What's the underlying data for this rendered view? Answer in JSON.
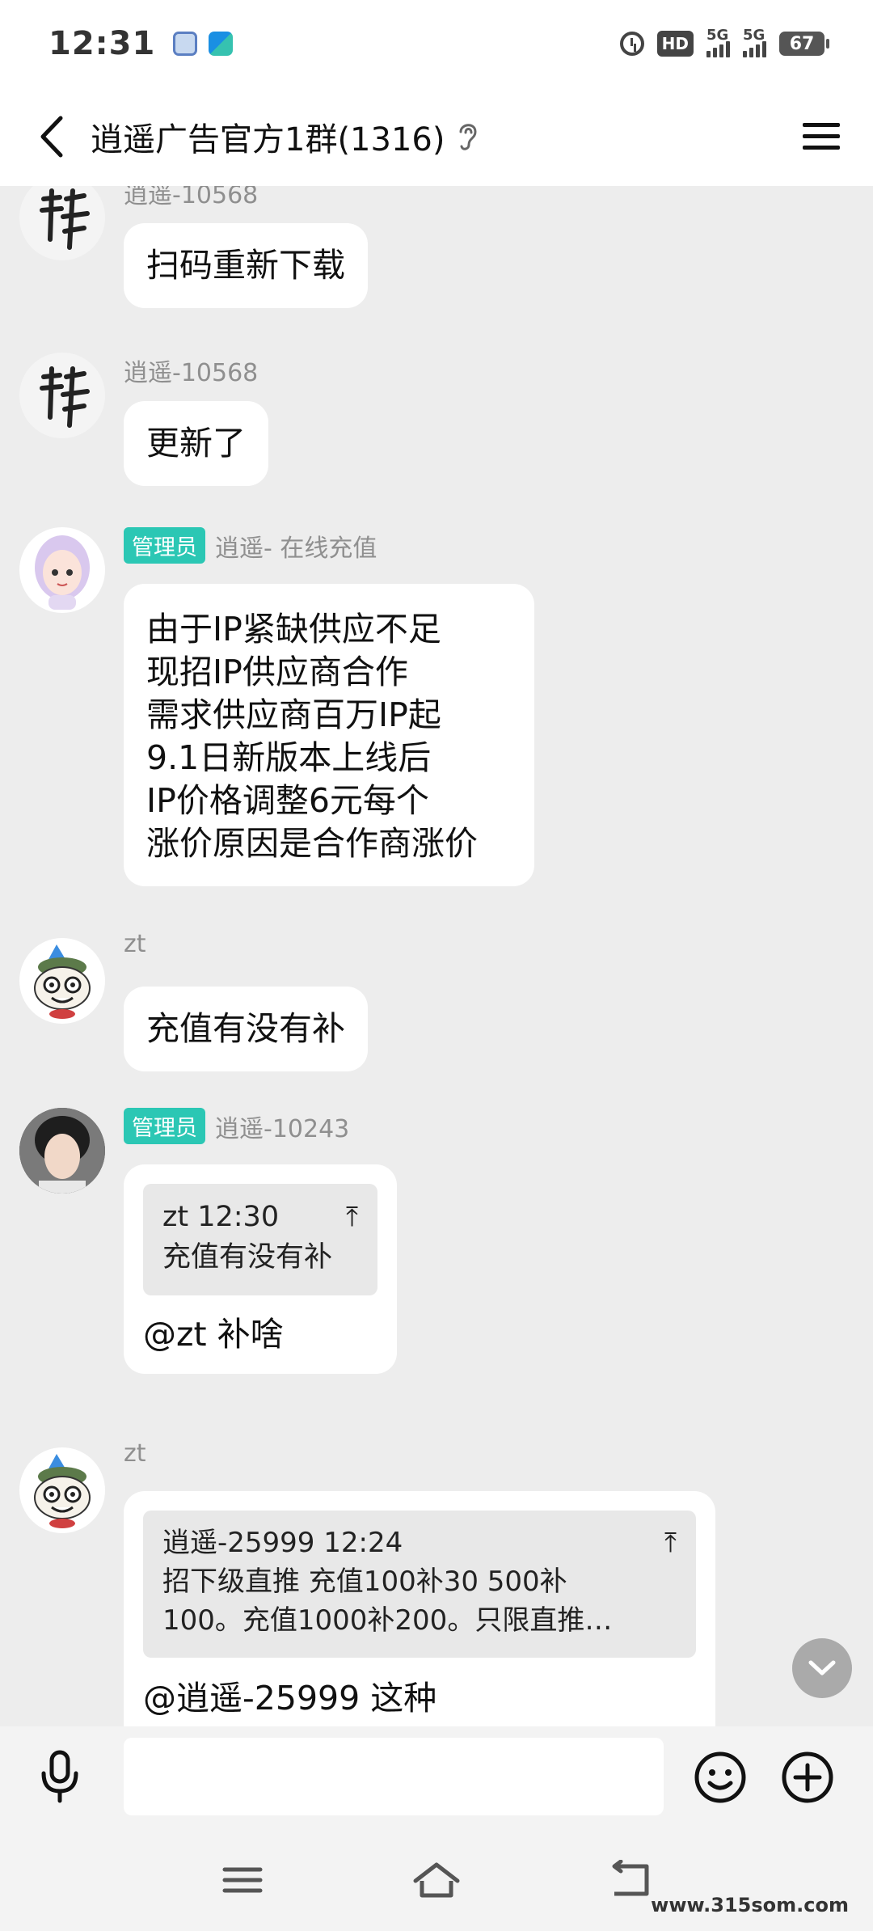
{
  "status_bar": {
    "time": "12:31",
    "hd_label": "HD",
    "signal1_label": "5G",
    "signal2_label": "5G",
    "battery": "67"
  },
  "header": {
    "back_icon": "chevron-left-icon",
    "title": "逍遥广告官方1群(1316)",
    "ear_icon": "ear-icon",
    "menu_icon": "hamburger-menu-icon"
  },
  "messages": [
    {
      "sender": "逍遥-10568",
      "text": "扫码重新下载"
    },
    {
      "sender": "逍遥-10568",
      "text": "更新了"
    },
    {
      "badge": "管理员",
      "sender": "逍遥- 在线充值",
      "lines": [
        "由于IP紧缺供应不足",
        "现招IP供应商合作",
        "需求供应商百万IP起",
        "9.1日新版本上线后",
        "IP价格调整6元每个",
        "涨价原因是合作商涨价"
      ]
    },
    {
      "sender": "zt",
      "text": "充值有没有补"
    },
    {
      "badge": "管理员",
      "sender": "逍遥-10243",
      "quote_head": "zt 12:30",
      "quote_text": "充值有没有补",
      "text": "@zt 补啥"
    },
    {
      "sender": "zt",
      "quote_head": "逍遥-25999 12:24",
      "quote_line1": "招下级直推  充值100补30  500补",
      "quote_line2": "100。充值1000补200。只限直推…",
      "text": "@逍遥-25999 这种"
    }
  ],
  "input": {
    "placeholder": ""
  },
  "watermark": "www.315som.com",
  "colors": {
    "badge": "#2bc7b4",
    "background": "#ededed",
    "bubble": "#ffffff"
  }
}
